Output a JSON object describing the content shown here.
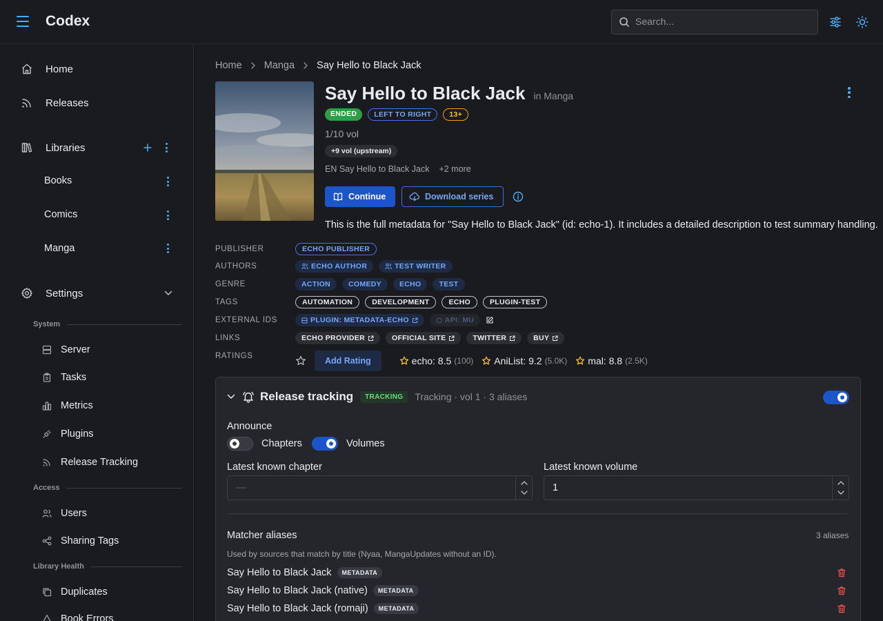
{
  "app": {
    "title": "Codex"
  },
  "search": {
    "placeholder": "Search..."
  },
  "sidebar": {
    "home": "Home",
    "releases": "Releases",
    "libraries": "Libraries",
    "library_items": [
      "Books",
      "Comics",
      "Manga"
    ],
    "settings": "Settings",
    "system_label": "System",
    "system_items": [
      "Server",
      "Tasks",
      "Metrics",
      "Plugins",
      "Release Tracking"
    ],
    "access_label": "Access",
    "access_items": [
      "Users",
      "Sharing Tags"
    ],
    "health_label": "Library Health",
    "health_items": [
      "Duplicates",
      "Book Errors"
    ]
  },
  "breadcrumb": [
    "Home",
    "Manga",
    "Say Hello to Black Jack"
  ],
  "series": {
    "title": "Say Hello to Black Jack",
    "in_library": "in Manga",
    "status_badge": "ENDED",
    "direction_badge": "LEFT TO RIGHT",
    "age_badge": "13+",
    "volumes": "1/10 vol",
    "upstream": "+9 vol (upstream)",
    "alt_title": "EN Say Hello to Black Jack",
    "alt_more": "+2 more",
    "continue_label": "Continue",
    "download_label": "Download series",
    "summary": "This is the full metadata for \"Say Hello to Black Jack\" (id: echo-1). It includes a detailed description to test summary handling."
  },
  "metadata": {
    "publisher_label": "PUBLISHER",
    "publisher": [
      "ECHO PUBLISHER"
    ],
    "authors_label": "AUTHORS",
    "authors": [
      "ECHO AUTHOR",
      "TEST WRITER"
    ],
    "genre_label": "GENRE",
    "genres": [
      "ACTION",
      "COMEDY",
      "ECHO",
      "TEST"
    ],
    "tags_label": "TAGS",
    "tags": [
      "AUTOMATION",
      "DEVELOPMENT",
      "ECHO",
      "PLUGIN-TEST"
    ],
    "external_ids_label": "EXTERNAL IDS",
    "external_ids": [
      "PLUGIN: METADATA-ECHO",
      "API: MU"
    ],
    "links_label": "LINKS",
    "links": [
      "ECHO PROVIDER",
      "OFFICIAL SITE",
      "TWITTER",
      "BUY"
    ],
    "ratings_label": "RATINGS",
    "add_rating_label": "Add Rating",
    "ratings": [
      {
        "source": "echo: 8.5",
        "count": "(100)"
      },
      {
        "source": "AniList: 9.2",
        "count": "(5.0K)"
      },
      {
        "source": "mal: 8.8",
        "count": "(2.5K)"
      }
    ]
  },
  "tracking": {
    "title": "Release tracking",
    "badge": "TRACKING",
    "subtitle": "Tracking · vol 1 · 3 aliases",
    "enabled": true,
    "announce_label": "Announce",
    "chapters_label": "Chapters",
    "chapters_on": false,
    "volumes_label": "Volumes",
    "volumes_on": true,
    "latest_chapter_label": "Latest known chapter",
    "latest_chapter_placeholder": "—",
    "latest_volume_label": "Latest known volume",
    "latest_volume_value": "1",
    "aliases_label": "Matcher aliases",
    "aliases_count": "3 aliases",
    "aliases_hint": "Used by sources that match by title (Nyaa, MangaUpdates without an ID).",
    "aliases": [
      {
        "name": "Say Hello to Black Jack",
        "tag": "METADATA"
      },
      {
        "name": "Say Hello to Black Jack (native)",
        "tag": "METADATA"
      },
      {
        "name": "Say Hello to Black Jack (romaji)",
        "tag": "METADATA"
      }
    ]
  },
  "colors": {
    "accent": "#4dabf7",
    "primary_button": "#1c54c9",
    "status_green": "#2f9e44",
    "background": "#1a1b1e"
  }
}
